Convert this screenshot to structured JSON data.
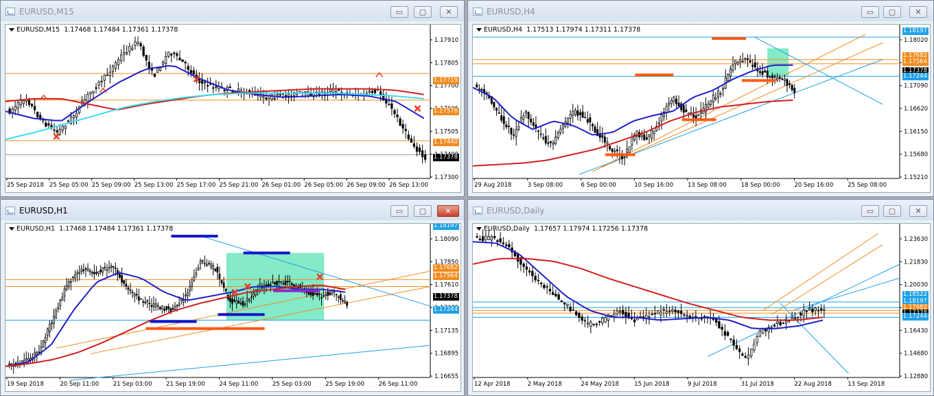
{
  "windows": [
    {
      "id": "m15",
      "title": "EURUSD,M15",
      "header": "EURUSD,M15  1.17468 1.17484 1.17361 1.17378",
      "active": false,
      "price_scale": [
        "1.17910",
        "1.17805",
        "1.17700",
        "1.17605",
        "1.17505",
        "1.17400",
        "1.17300"
      ],
      "time_labels": [
        "25 Sep 2018",
        "25 Sep 05:00",
        "25 Sep 09:00",
        "25 Sep 13:00",
        "25 Sep 17:00",
        "25 Sep 21:00",
        "26 Sep 01:00",
        "26 Sep 05:00",
        "26 Sep 09:00",
        "26 Sep 13:00"
      ],
      "price_tags": [
        {
          "text": "1.17719",
          "color": "#f08c1e"
        },
        {
          "text": "1.17576",
          "color": "#f08c1e"
        },
        {
          "text": "1.17440",
          "color": "#f08c1e"
        },
        {
          "text": "1.17378",
          "color": "#000000"
        }
      ]
    },
    {
      "id": "h4",
      "title": "EURUSD,H4",
      "header": "EURUSD,H4  1.17513 1.17974 1.17311 1.17378",
      "active": false,
      "price_scale": [
        "1.18020",
        "1.17564",
        "1.17090",
        "1.16620",
        "1.16150",
        "1.15680",
        "1.15210"
      ],
      "time_labels": [
        "29 Aug 2018",
        "3 Sep 08:00",
        "6 Sep 00:00",
        "10 Sep 16:00",
        "13 Sep 08:00",
        "18 Sep 00:00",
        "20 Sep 16:00",
        "25 Sep 08:00"
      ],
      "price_tags": [
        {
          "text": "1.18197",
          "color": "#1ea0e6"
        },
        {
          "text": "1.17682",
          "color": "#f08c1e"
        },
        {
          "text": "1.17564",
          "color": "#f08c1e"
        },
        {
          "text": "1.17378",
          "color": "#000000"
        },
        {
          "text": "1.17244",
          "color": "#1ea0e6"
        }
      ]
    },
    {
      "id": "h1",
      "title": "EURUSD,H1",
      "header": "EURUSD,H1  1.17468 1.17484 1.17361 1.17378",
      "active": true,
      "price_scale": [
        "1.18090",
        "1.17850",
        "1.17610",
        "1.17375",
        "1.17135",
        "1.16895",
        "1.16655"
      ],
      "time_labels": [
        "19 Sep 2018",
        "20 Sep 11:00",
        "21 Sep 03:00",
        "21 Sep 19:00",
        "24 Sep 11:00",
        "25 Sep 03:00",
        "25 Sep 19:00",
        "26 Sep 11:00"
      ],
      "price_tags": [
        {
          "text": "1.18197",
          "color": "#1ea0e6"
        },
        {
          "text": "1.17682",
          "color": "#f08c1e"
        },
        {
          "text": "1.17564",
          "color": "#f08c1e"
        },
        {
          "text": "1.17378",
          "color": "#000000"
        },
        {
          "text": "1.17244",
          "color": "#1ea0e6"
        }
      ]
    },
    {
      "id": "daily",
      "title": "EURUSD,Daily",
      "header": "EURUSD,Daily  1.17657 1.17974 1.17256 1.17378",
      "active": false,
      "price_scale": [
        "1.23630",
        "1.21830",
        "1.20030",
        "1.18230",
        "1.16430",
        "1.14680",
        "1.12880"
      ],
      "time_labels": [
        "12 Apr 2018",
        "2 May 2018",
        "24 May 2018",
        "15 Jun 2018",
        "9 Jul 2018",
        "31 Jul 2018",
        "22 Aug 2018",
        "13 Sep 2018"
      ],
      "price_tags": [
        {
          "text": "1.18522",
          "color": "#1ea0e6"
        },
        {
          "text": "1.18197",
          "color": "#1ea0e6"
        },
        {
          "text": "1.17682",
          "color": "#f08c1e"
        },
        {
          "text": "1.17378",
          "color": "#000000"
        },
        {
          "text": "1.17244",
          "color": "#1ea0e6"
        }
      ]
    }
  ],
  "buttons": {
    "minimize": "▭",
    "maximize": "▢",
    "close": "✕"
  },
  "colors": {
    "bull_bear": "#000000",
    "ma_fast": "#1e1ec8",
    "ma_slow": "#d21e1e",
    "ma_cyan": "#3cdcf0",
    "level_orange": "#f08c1e",
    "level_blue": "#1ea0e6",
    "zone_green": "#6ee6be",
    "marker_red": "#e63c28",
    "bar_orange": "#ff5a14",
    "bar_blue": "#1414c8",
    "bar_purple": "#8c28c8"
  }
}
